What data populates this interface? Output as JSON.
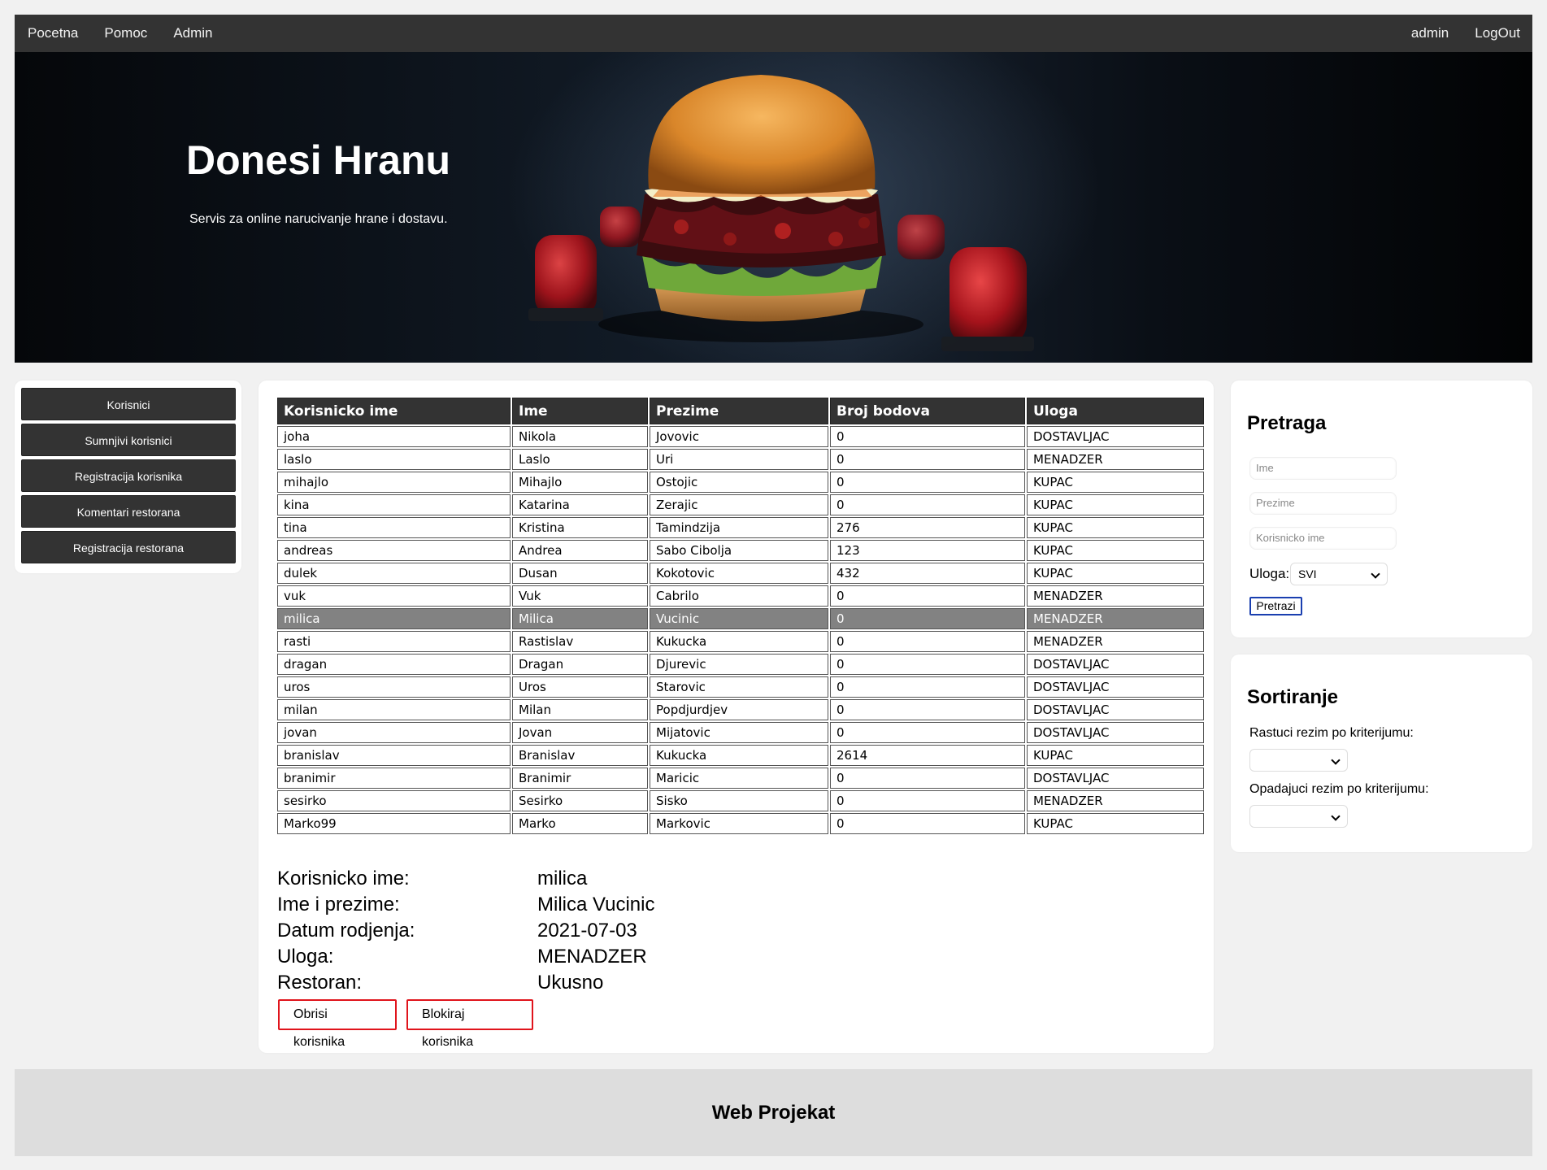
{
  "nav": {
    "links": [
      "Pocetna",
      "Pomoc",
      "Admin"
    ],
    "user": "admin",
    "logout": "LogOut"
  },
  "hero": {
    "title": "Donesi Hranu",
    "subtitle": "Servis za online narucivanje hrane i dostavu."
  },
  "sidebar": {
    "items": [
      {
        "label": "Korisnici"
      },
      {
        "label": "Sumnjivi korisnici"
      },
      {
        "label": "Registracija korisnika"
      },
      {
        "label": "Komentari restorana"
      },
      {
        "label": "Registracija restorana"
      }
    ]
  },
  "table": {
    "headers": [
      "Korisnicko ime",
      "Ime",
      "Prezime",
      "Broj bodova",
      "Uloga"
    ],
    "selected_index": 8,
    "rows": [
      [
        "joha",
        "Nikola",
        "Jovovic",
        "0",
        "DOSTAVLJAC"
      ],
      [
        "laslo",
        "Laslo",
        "Uri",
        "0",
        "MENADZER"
      ],
      [
        "mihajlo",
        "Mihajlo",
        "Ostojic",
        "0",
        "KUPAC"
      ],
      [
        "kina",
        "Katarina",
        "Zerajic",
        "0",
        "KUPAC"
      ],
      [
        "tina",
        "Kristina",
        "Tamindzija",
        "276",
        "KUPAC"
      ],
      [
        "andreas",
        "Andrea",
        "Sabo Cibolja",
        "123",
        "KUPAC"
      ],
      [
        "dulek",
        "Dusan",
        "Kokotovic",
        "432",
        "KUPAC"
      ],
      [
        "vuk",
        "Vuk",
        "Cabrilo",
        "0",
        "MENADZER"
      ],
      [
        "milica",
        "Milica",
        "Vucinic",
        "0",
        "MENADZER"
      ],
      [
        "rasti",
        "Rastislav",
        "Kukucka",
        "0",
        "MENADZER"
      ],
      [
        "dragan",
        "Dragan",
        "Djurevic",
        "0",
        "DOSTAVLJAC"
      ],
      [
        "uros",
        "Uros",
        "Starovic",
        "0",
        "DOSTAVLJAC"
      ],
      [
        "milan",
        "Milan",
        "Popdjurdjev",
        "0",
        "DOSTAVLJAC"
      ],
      [
        "jovan",
        "Jovan",
        "Mijatovic",
        "0",
        "DOSTAVLJAC"
      ],
      [
        "branislav",
        "Branislav",
        "Kukucka",
        "2614",
        "KUPAC"
      ],
      [
        "branimir",
        "Branimir",
        "Maricic",
        "0",
        "DOSTAVLJAC"
      ],
      [
        "sesirko",
        "Sesirko",
        "Sisko",
        "0",
        "MENADZER"
      ],
      [
        "Marko99",
        "Marko",
        "Markovic",
        "0",
        "KUPAC"
      ]
    ]
  },
  "details": {
    "rows": [
      {
        "label": "Korisnicko ime:",
        "value": "milica"
      },
      {
        "label": "Ime i prezime:",
        "value": "Milica Vucinic"
      },
      {
        "label": "Datum rodjenja:",
        "value": "2021-07-03"
      },
      {
        "label": "Uloga:",
        "value": "MENADZER"
      },
      {
        "label": "Restoran:",
        "value": "Ukusno"
      }
    ],
    "delete_label": "Obrisi korisnika",
    "block_label": "Blokiraj korisnika"
  },
  "search": {
    "title": "Pretraga",
    "ime_placeholder": "Ime",
    "prezime_placeholder": "Prezime",
    "korisnicko_placeholder": "Korisnicko ime",
    "uloga_label": "Uloga:",
    "uloga_value": "SVI",
    "button": "Pretrazi"
  },
  "sort": {
    "title": "Sortiranje",
    "asc_label": "Rastuci rezim po kriterijumu:",
    "asc_value": "",
    "desc_label": "Opadajuci rezim po kriterijumu:",
    "desc_value": ""
  },
  "footer": {
    "title": "Web Projekat"
  },
  "colors": {
    "nav_bg": "#333333",
    "selected_row": "#828282",
    "danger_border": "#e0141c",
    "search_btn_border": "#1a3fb0",
    "footer_bg": "#dddddd"
  }
}
